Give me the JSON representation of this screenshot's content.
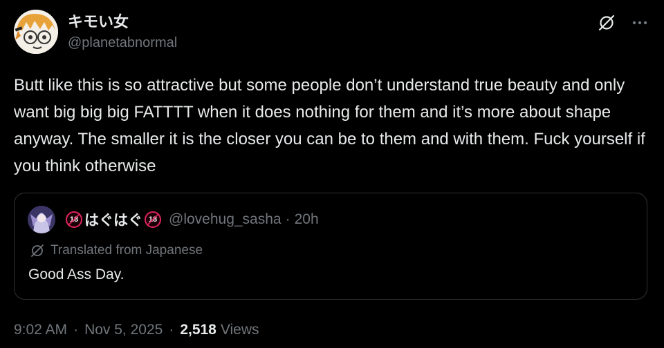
{
  "author": {
    "display_name": "キモい女",
    "handle": "@planetabnormal"
  },
  "post": {
    "text": "Butt like this is so attractive but some people don’t understand true beauty and only want big big big FATTTT when it does nothing for them and it’s more about shape anyway. The smaller it is the closer you can be to them and with them. Fuck yourself if you think otherwise"
  },
  "quoted_post": {
    "badge_text": "18",
    "name_text": "はぐはぐ",
    "handle": "@lovehug_sasha",
    "separator": "·",
    "time": "20h",
    "translated_label": "Translated from Japanese",
    "text": "Good Ass Day."
  },
  "meta": {
    "time": "9:02 AM",
    "separator": "·",
    "date": "Nov 5, 2025",
    "views_count": "2,518",
    "views_label": "Views"
  },
  "icons": {
    "grok": "slashed-circle-icon",
    "more": "more-dots-icon",
    "translate": "slashed-circle-icon"
  },
  "colors": {
    "background": "#000000",
    "primary_text": "#e7e9ea",
    "secondary_text": "#71767b",
    "border": "#2f3336",
    "badge_red": "#e0245e"
  }
}
